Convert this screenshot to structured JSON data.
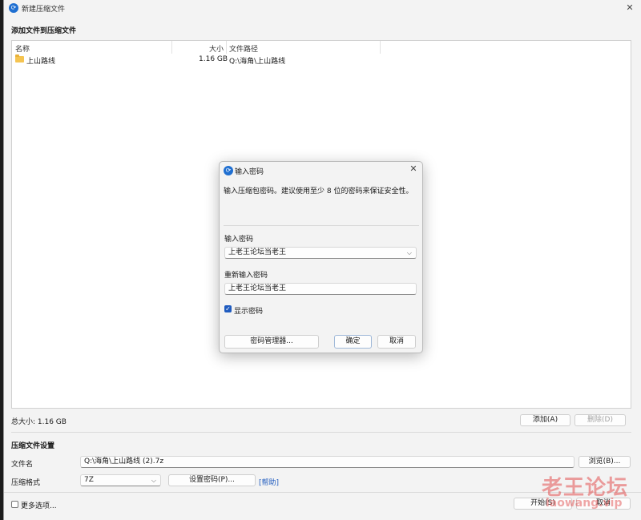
{
  "window": {
    "title": "新建压缩文件",
    "close_glyph": "✕"
  },
  "add_section": {
    "title": "添加文件到压缩文件"
  },
  "file_list": {
    "columns": [
      "名称",
      "大小",
      "文件路径"
    ],
    "rows": [
      {
        "name": "上山路线",
        "size": "1.16 GB",
        "path": "Q:\\海角\\上山路线"
      }
    ]
  },
  "summary": {
    "total_size": "总大小: 1.16 GB"
  },
  "list_buttons": {
    "add": "添加(A)",
    "delete": "删除(D)"
  },
  "settings": {
    "title": "压缩文件设置",
    "filename_label": "文件名",
    "filename_value": "Q:\\海角\\上山路线 (2).7z",
    "browse": "浏览(B)...",
    "format_label": "压缩格式",
    "format_value": "7Z",
    "set_password": "设置密码(P)...",
    "help": "[帮助]"
  },
  "bottom": {
    "more_options": "更多选项...",
    "start": "开始(S)",
    "cancel": "取消"
  },
  "dialog": {
    "title": "输入密码",
    "close_glyph": "✕",
    "message": "输入压缩包密码。建议使用至少 8 位的密码来保证安全性。",
    "password_label": "输入密码",
    "password_value": "上老王论坛当老王",
    "reenter_label": "重新输入密码",
    "reenter_value": "上老王论坛当老王",
    "show_password": "显示密码",
    "manager": "密码管理器...",
    "ok": "确定",
    "cancel": "取消"
  },
  "watermark": {
    "text": "老王论坛",
    "url": "laowang.vip"
  },
  "colors": {
    "accent": "#1f5bbf",
    "app_icon": "#1f6fd1",
    "folder": "#f5c451"
  },
  "icons": {
    "app": "app-logo-icon",
    "folder": "folder-icon",
    "dropdown": "chevron-down-icon",
    "check": "checkmark-icon"
  }
}
